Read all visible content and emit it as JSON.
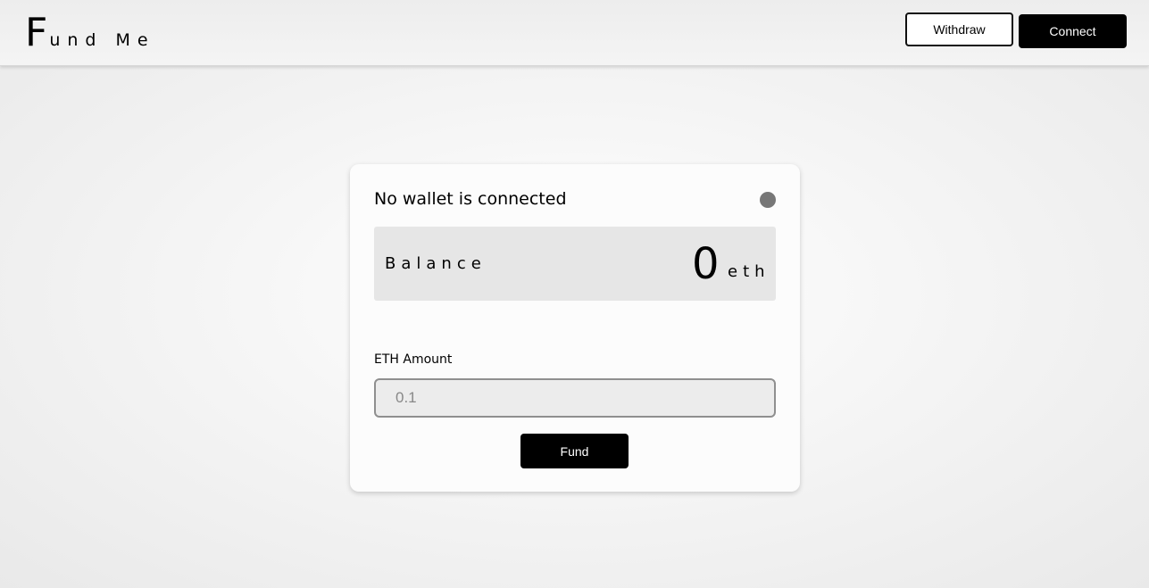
{
  "header": {
    "logo_first": "F",
    "logo_rest": "und Me",
    "withdraw_label": "Withdraw",
    "connect_label": "Connect"
  },
  "card": {
    "status_text": "No wallet is connected",
    "status_dot_color": "#777777",
    "balance_label": "Balance",
    "balance_value": "0",
    "balance_unit": "eth",
    "amount_label": "ETH Amount",
    "amount_placeholder": "0.1",
    "fund_label": "Fund"
  },
  "colors": {
    "accent": "#000000",
    "balance_bg": "#e6e6e6"
  }
}
